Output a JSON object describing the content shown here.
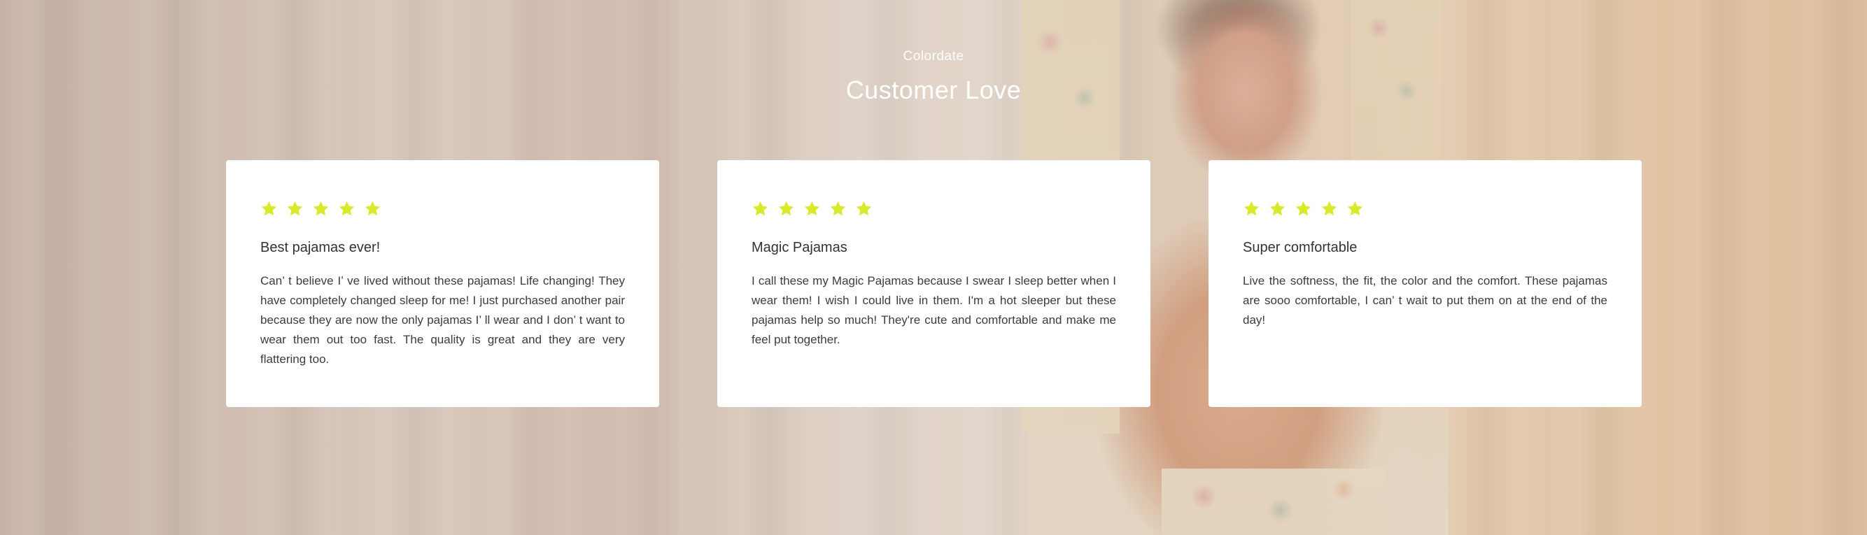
{
  "header": {
    "brand": "Colordate",
    "title": "Customer Love"
  },
  "colors": {
    "star": "#d9ea2b",
    "card_bg": "#ffffff",
    "text": "#333333"
  },
  "reviews": [
    {
      "rating": 5,
      "title": "Best pajamas ever!",
      "body": "Can’ t believe I’ ve lived without these pajamas! Life changing! They have completely changed sleep for me! I just purchased another pair because they are now the only pajamas I’ ll wear and I don’ t want to wear them out too fast. The quality is great and they are very flattering too."
    },
    {
      "rating": 5,
      "title": "Magic Pajamas",
      "body": "I call these my Magic Pajamas because I swear I sleep better when I wear them! I wish I could live in them. I'm a hot sleeper but these pajamas help so much! They're cute and comfortable and make me feel put together."
    },
    {
      "rating": 5,
      "title": "Super comfortable",
      "body": "Live the softness, the fit, the color and the comfort. These pajamas are sooo comfortable, I can’ t wait to put them on at the end of the day!"
    }
  ]
}
